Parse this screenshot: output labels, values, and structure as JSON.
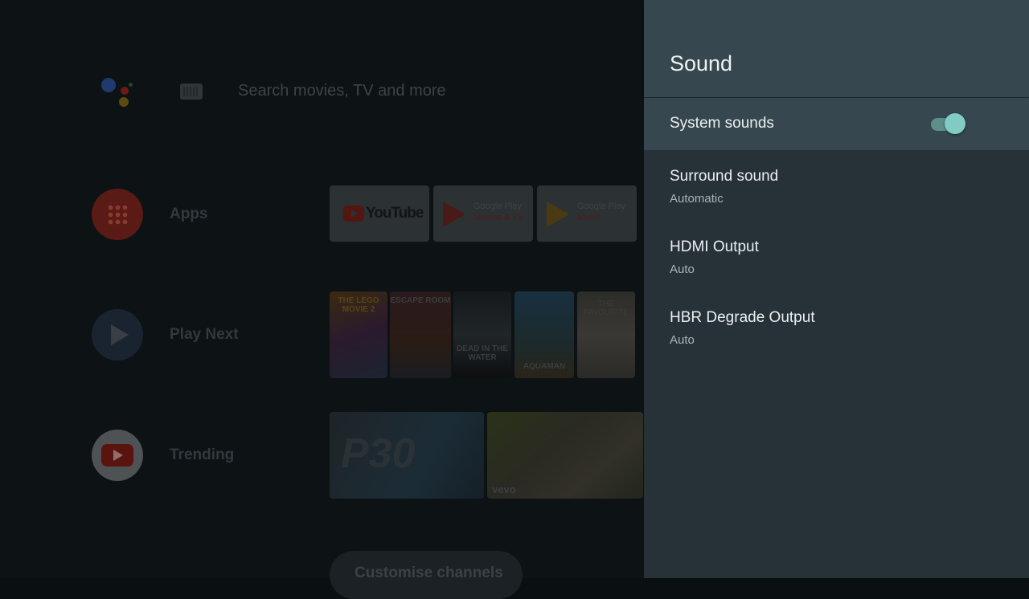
{
  "home": {
    "search_placeholder": "Search movies, TV and more",
    "rows": {
      "apps_label": "Apps",
      "play_next_label": "Play Next",
      "trending_label": "Trending"
    },
    "app_tiles": [
      {
        "name": "YouTube",
        "logo_text": "YouTube"
      },
      {
        "line1": "Google Play",
        "line2": "Movies & TV"
      },
      {
        "line1": "Google Play",
        "line2": "Music"
      }
    ],
    "posters": [
      "THE LEGO MOVIE 2",
      "ESCAPE ROOM",
      "DEAD IN THE WATER",
      "AQUAMAN",
      "THE FAVOURITE"
    ],
    "trending": {
      "video1_text": "P30",
      "video2_text": "vevo"
    },
    "customise_label": "Customise channels"
  },
  "settings": {
    "title": "Sound",
    "items": [
      {
        "title": "System sounds",
        "toggle_on": true
      },
      {
        "title": "Surround sound",
        "subtitle": "Automatic"
      },
      {
        "title": "HDMI Output",
        "subtitle": "Auto"
      },
      {
        "title": "HBR Degrade Output",
        "subtitle": "Auto"
      }
    ]
  },
  "colors": {
    "panel_bg": "#263238",
    "panel_header_bg": "#37474f",
    "accent_toggle": "#80cbc4"
  },
  "icons": [
    "google-assistant-icon",
    "keyboard-icon",
    "apps-grid-icon",
    "play-icon",
    "youtube-icon"
  ]
}
